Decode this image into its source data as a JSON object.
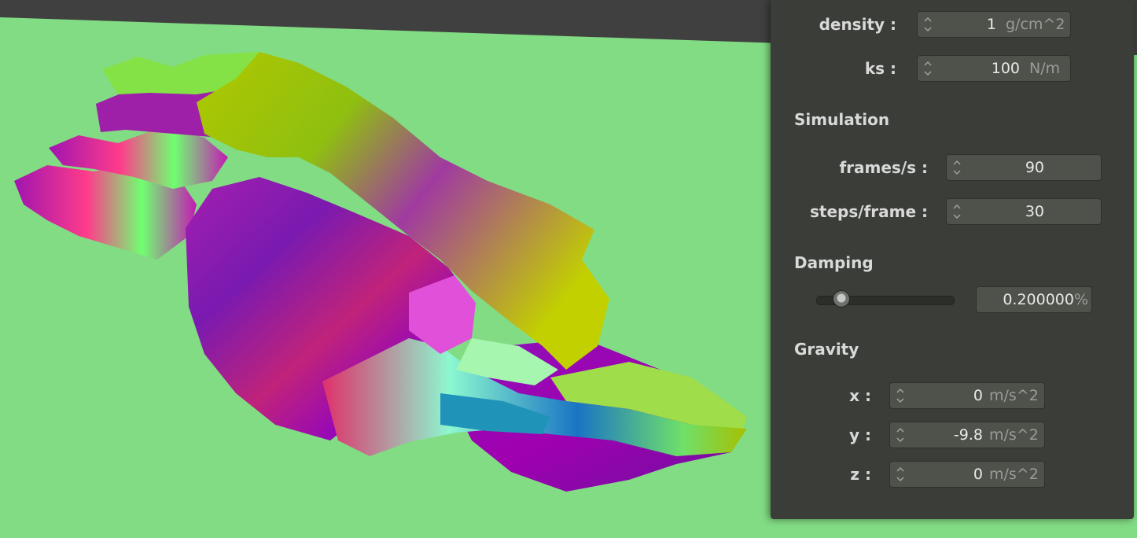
{
  "material": {
    "density": {
      "label": "density :",
      "value": "1",
      "unit": "g/cm^2"
    },
    "ks": {
      "label": "ks :",
      "value": "100",
      "unit": "N/m"
    }
  },
  "simulation": {
    "title": "Simulation",
    "frames": {
      "label": "frames/s :",
      "value": "90"
    },
    "steps": {
      "label": "steps/frame :",
      "value": "30"
    }
  },
  "damping": {
    "title": "Damping",
    "slider_fraction": 0.2,
    "value": "0.200000",
    "unit": "%"
  },
  "gravity": {
    "title": "Gravity",
    "x": {
      "label": "x :",
      "value": "0",
      "unit": "m/s^2"
    },
    "y": {
      "label": "y :",
      "value": "-9.8",
      "unit": "m/s^2"
    },
    "z": {
      "label": "z :",
      "value": "0",
      "unit": "m/s^2"
    }
  },
  "colors": {
    "background": "#82dc84",
    "panel": "#3b3e38",
    "field": "#4e524b",
    "cloth_palette": [
      "#9a00d0",
      "#7d1fb0",
      "#b8d400",
      "#6cff6c",
      "#ff2a7a",
      "#1a6ec8"
    ]
  }
}
